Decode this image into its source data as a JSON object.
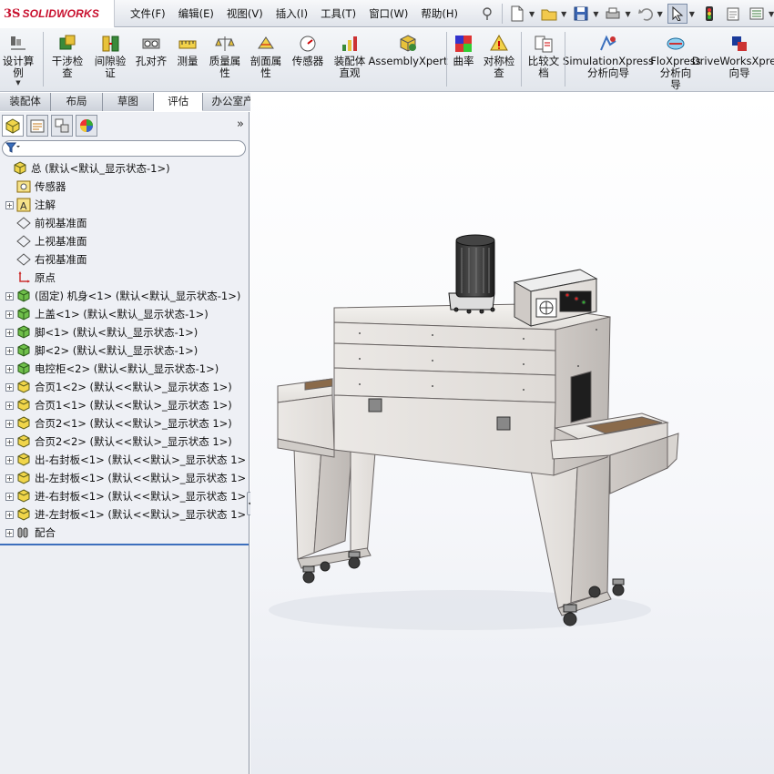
{
  "app": {
    "logo_mark": "3S",
    "logo_text": "SOLIDWORKS"
  },
  "menu": {
    "items": [
      "文件(F)",
      "编辑(E)",
      "视图(V)",
      "插入(I)",
      "工具(T)",
      "窗口(W)",
      "帮助(H)"
    ]
  },
  "command_manager": {
    "buttons": [
      {
        "label": "设计算\n例",
        "icon": "design-study-icon"
      },
      {
        "label": "干涉检\n查",
        "icon": "interference-check-icon"
      },
      {
        "label": "间隙验\n证",
        "icon": "clearance-verify-icon"
      },
      {
        "label": "孔对齐",
        "icon": "hole-alignment-icon"
      },
      {
        "label": "测量",
        "icon": "measure-icon"
      },
      {
        "label": "质量属\n性",
        "icon": "mass-properties-icon"
      },
      {
        "label": "剖面属\n性",
        "icon": "section-properties-icon"
      },
      {
        "label": "传感器",
        "icon": "sensor-icon"
      },
      {
        "label": "装配体\n直观",
        "icon": "assembly-visualization-icon"
      },
      {
        "label": "AssemblyXpert",
        "icon": "assemblyxpert-icon"
      },
      {
        "label": "曲率",
        "icon": "curvature-icon"
      },
      {
        "label": "对称检\n查",
        "icon": "symmetry-check-icon"
      },
      {
        "label": "比较文\n档",
        "icon": "compare-documents-icon"
      },
      {
        "label": "SimulationXpress\n分析向导",
        "icon": "simulationxpress-icon"
      },
      {
        "label": "FloXpress\n分析向\n导",
        "icon": "floxpress-icon"
      },
      {
        "label": "DriveWorksXpress\n向导",
        "icon": "driveworksxpress-icon"
      }
    ]
  },
  "tabs": [
    "装配体",
    "布局",
    "草图",
    "评估",
    "办公室产品"
  ],
  "active_tab": "评估",
  "feature_tree": {
    "nodes": [
      {
        "label": "总  (默认<默认_显示状态-1>)",
        "icon": "assembly-icon",
        "expander": false,
        "indent": 0
      },
      {
        "label": "传感器",
        "icon": "sensor-folder-icon",
        "expander": false,
        "indent": 1
      },
      {
        "label": "注解",
        "icon": "annotation-icon",
        "expander": true,
        "indent": 1
      },
      {
        "label": "前视基准面",
        "icon": "plane-icon",
        "expander": false,
        "indent": 1
      },
      {
        "label": "上视基准面",
        "icon": "plane-icon",
        "expander": false,
        "indent": 1
      },
      {
        "label": "右视基准面",
        "icon": "plane-icon",
        "expander": false,
        "indent": 1
      },
      {
        "label": "原点",
        "icon": "origin-icon",
        "expander": false,
        "indent": 1
      },
      {
        "label": "(固定) 机身<1> (默认<默认_显示状态-1>)",
        "icon": "subassembly-icon",
        "expander": true,
        "indent": 1
      },
      {
        "label": "上盖<1> (默认<默认_显示状态-1>)",
        "icon": "subassembly-icon",
        "expander": true,
        "indent": 1
      },
      {
        "label": "脚<1> (默认<默认_显示状态-1>)",
        "icon": "subassembly-icon",
        "expander": true,
        "indent": 1
      },
      {
        "label": "脚<2> (默认<默认_显示状态-1>)",
        "icon": "subassembly-icon",
        "expander": true,
        "indent": 1
      },
      {
        "label": "电控柜<2> (默认<默认_显示状态-1>)",
        "icon": "subassembly-icon",
        "expander": true,
        "indent": 1
      },
      {
        "label": "合页1<2> (默认<<默认>_显示状态 1>)",
        "icon": "part-icon",
        "expander": true,
        "indent": 1
      },
      {
        "label": "合页1<1> (默认<<默认>_显示状态 1>)",
        "icon": "part-icon",
        "expander": true,
        "indent": 1
      },
      {
        "label": "合页2<1> (默认<<默认>_显示状态 1>)",
        "icon": "part-icon",
        "expander": true,
        "indent": 1
      },
      {
        "label": "合页2<2> (默认<<默认>_显示状态 1>)",
        "icon": "part-icon",
        "expander": true,
        "indent": 1
      },
      {
        "label": "出-右封板<1> (默认<<默认>_显示状态 1>",
        "icon": "part-icon",
        "expander": true,
        "indent": 1
      },
      {
        "label": "出-左封板<1> (默认<<默认>_显示状态 1>",
        "icon": "part-icon",
        "expander": true,
        "indent": 1
      },
      {
        "label": "进-右封板<1> (默认<<默认>_显示状态 1>",
        "icon": "part-icon",
        "expander": true,
        "indent": 1
      },
      {
        "label": "进-左封板<1> (默认<<默认>_显示状态 1>",
        "icon": "part-icon",
        "expander": true,
        "indent": 1
      },
      {
        "label": "配合",
        "icon": "mates-icon",
        "expander": true,
        "indent": 1
      }
    ]
  },
  "colors": {
    "accent_red": "#c8102e",
    "panel_bg": "#eef0f5",
    "machine_body": "#e4e1de",
    "machine_edge": "#6a6564",
    "conveyor_belt": "#8a6a4a"
  }
}
